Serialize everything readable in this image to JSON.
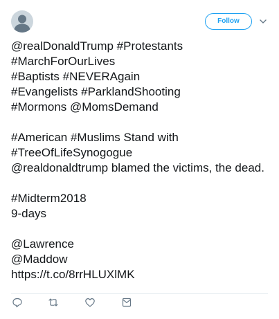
{
  "header": {
    "avatar_icon": "default-profile-icon",
    "follow_label": "Follow",
    "more_icon": "chevron-down-icon"
  },
  "tweet": {
    "paragraphs": [
      [
        "@realDonaldTrump #Protestants",
        "#MarchForOurLives",
        "#Baptists #NEVERAgain",
        "#Evangelists #ParklandShooting",
        "#Mormons @MomsDemand"
      ],
      [
        "#American #Muslims Stand with",
        "#TreeOfLifeSynogogue",
        "@realdonaldtrump blamed the victims, the dead."
      ],
      [
        "#Midterm2018",
        "9-days"
      ],
      [
        "@Lawrence",
        "@Maddow",
        "https://t.co/8rrHLUXlMK"
      ]
    ]
  },
  "actions": {
    "reply_icon": "reply-icon",
    "retweet_icon": "retweet-icon",
    "like_icon": "heart-icon",
    "dm_icon": "envelope-icon"
  },
  "colors": {
    "accent": "#1da1f2",
    "text": "#14171a",
    "icon": "#657786",
    "divider": "#e6ecf0",
    "avatar_bg": "#ccd6dd",
    "avatar_fg": "#657786"
  }
}
